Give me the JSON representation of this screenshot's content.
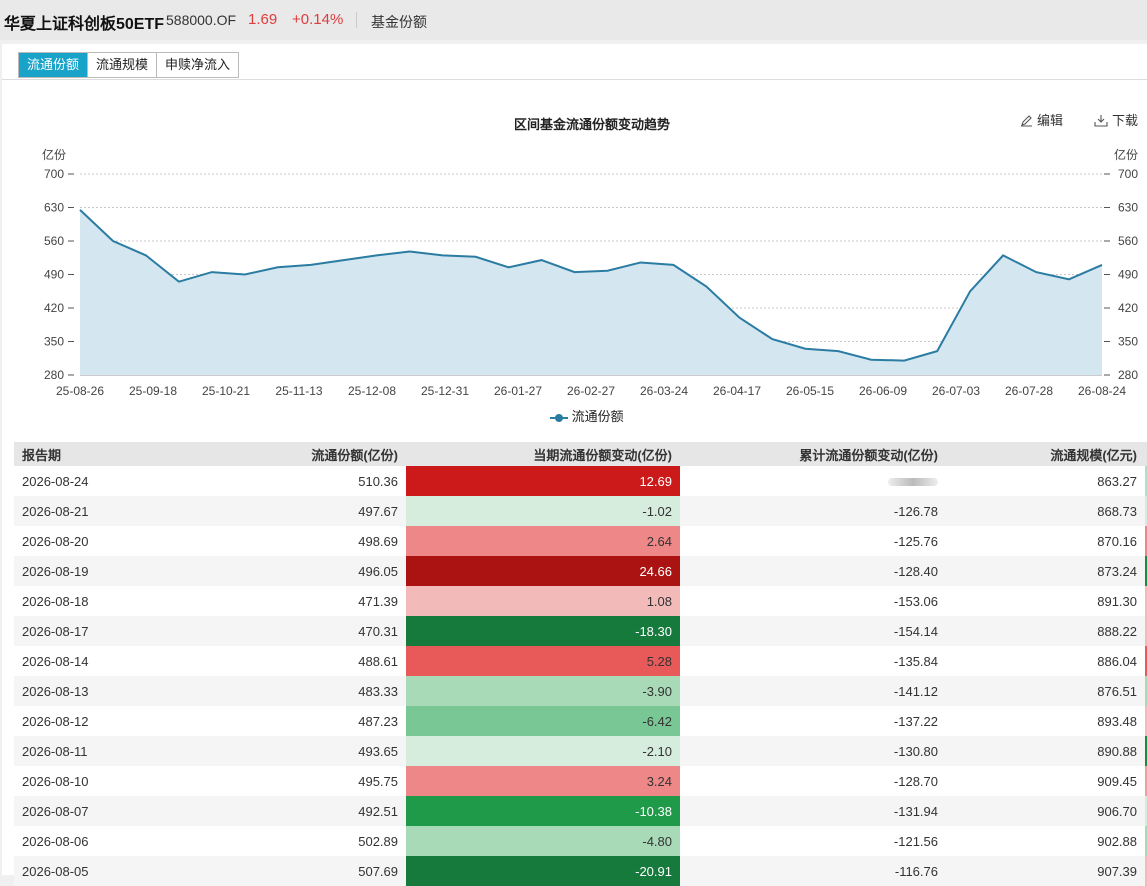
{
  "header": {
    "fund_name": "华夏上证科创板50ETF",
    "code": "588000.OF",
    "price": "1.69",
    "change": "+0.14%",
    "section": "基金份额"
  },
  "tabs": [
    "流通份额",
    "流通规模",
    "申赎净流入"
  ],
  "toolbar": {
    "edit": "编辑",
    "download": "下载"
  },
  "chart_data": {
    "type": "area",
    "title": "区间基金流通份额变动趋势",
    "ylabel_left": "亿份",
    "ylabel_right": "亿份",
    "ylim": [
      280,
      700
    ],
    "yticks": [
      280,
      350,
      420,
      490,
      560,
      630,
      700
    ],
    "xticks": [
      "25-08-26",
      "25-09-18",
      "25-10-21",
      "25-11-13",
      "25-12-08",
      "25-12-31",
      "26-01-27",
      "26-02-27",
      "26-03-24",
      "26-04-17",
      "26-05-15",
      "26-06-09",
      "26-07-03",
      "26-07-28",
      "26-08-24"
    ],
    "grid": true,
    "legend": "bottom",
    "series": [
      {
        "name": "流通份额",
        "color": "#2a7ca3",
        "fill": "#d4e6ef",
        "x": [
          "25-08-26",
          "25-09-05",
          "25-09-18",
          "25-09-30",
          "25-10-10",
          "25-10-21",
          "25-11-01",
          "25-11-13",
          "25-11-25",
          "25-12-08",
          "25-12-20",
          "25-12-31",
          "26-01-12",
          "26-01-27",
          "26-02-10",
          "26-02-27",
          "26-03-10",
          "26-03-24",
          "26-04-05",
          "26-04-17",
          "26-04-30",
          "26-05-15",
          "26-05-28",
          "26-06-09",
          "26-06-20",
          "26-07-03",
          "26-07-10",
          "26-07-18",
          "26-07-28",
          "26-08-05",
          "26-08-12",
          "26-08-24"
        ],
        "y": [
          625,
          560,
          530,
          475,
          495,
          490,
          505,
          510,
          520,
          530,
          538,
          530,
          527,
          505,
          520,
          495,
          498,
          515,
          510,
          465,
          400,
          355,
          335,
          330,
          312,
          310,
          330,
          455,
          530,
          495,
          480,
          510
        ]
      }
    ]
  },
  "table": {
    "columns": [
      "报告期",
      "流通份额(亿份)",
      "当期流通份额变动(亿份)",
      "累计流通份额变动(亿份)",
      "流通规模(亿元)"
    ],
    "rows": [
      {
        "date": "2026-08-24",
        "share": "510.36",
        "change": "12.69",
        "cum": "",
        "scale": "863.27",
        "bg": "#cc1a1a",
        "edge": "#b5dfc3"
      },
      {
        "date": "2026-08-21",
        "share": "497.67",
        "change": "-1.02",
        "cum": "-126.78",
        "scale": "868.73",
        "bg": "#d6ecdd",
        "edge": "#d6ecdd"
      },
      {
        "date": "2026-08-20",
        "share": "498.69",
        "change": "2.64",
        "cum": "-125.76",
        "scale": "870.16",
        "bg": "#ee8787",
        "edge": "#ee8787"
      },
      {
        "date": "2026-08-19",
        "share": "496.05",
        "change": "24.66",
        "cum": "-128.40",
        "scale": "873.24",
        "bg": "#ab1313",
        "edge": "#1a8c3f"
      },
      {
        "date": "2026-08-18",
        "share": "471.39",
        "change": "1.08",
        "cum": "-153.06",
        "scale": "891.30",
        "bg": "#f3baba",
        "edge": "#f3baba"
      },
      {
        "date": "2026-08-17",
        "share": "470.31",
        "change": "-18.30",
        "cum": "-154.14",
        "scale": "888.22",
        "bg": "#157a3c",
        "edge": "#f3baba"
      },
      {
        "date": "2026-08-14",
        "share": "488.61",
        "change": "5.28",
        "cum": "-135.84",
        "scale": "886.04",
        "bg": "#e85a5a",
        "edge": "#e85a5a"
      },
      {
        "date": "2026-08-13",
        "share": "483.33",
        "change": "-3.90",
        "cum": "-141.12",
        "scale": "876.51",
        "bg": "#a8dab8",
        "edge": "#a8dab8"
      },
      {
        "date": "2026-08-12",
        "share": "487.23",
        "change": "-6.42",
        "cum": "-137.22",
        "scale": "893.48",
        "bg": "#79c794",
        "edge": "#f3baba"
      },
      {
        "date": "2026-08-11",
        "share": "493.65",
        "change": "-2.10",
        "cum": "-130.80",
        "scale": "890.88",
        "bg": "#d6ecdd",
        "edge": "#1a8c3f"
      },
      {
        "date": "2026-08-10",
        "share": "495.75",
        "change": "3.24",
        "cum": "-128.70",
        "scale": "909.45",
        "bg": "#ee8787",
        "edge": "#e8a0a0"
      },
      {
        "date": "2026-08-07",
        "share": "492.51",
        "change": "-10.38",
        "cum": "-131.94",
        "scale": "906.70",
        "bg": "#1f9a48",
        "edge": "#d6ecdd"
      },
      {
        "date": "2026-08-06",
        "share": "502.89",
        "change": "-4.80",
        "cum": "-121.56",
        "scale": "902.88",
        "bg": "#a8dab8",
        "edge": "#a8dab8"
      },
      {
        "date": "2026-08-05",
        "share": "507.69",
        "change": "-20.91",
        "cum": "-116.76",
        "scale": "907.39",
        "bg": "#157a3c",
        "edge": "#f3baba"
      }
    ]
  }
}
